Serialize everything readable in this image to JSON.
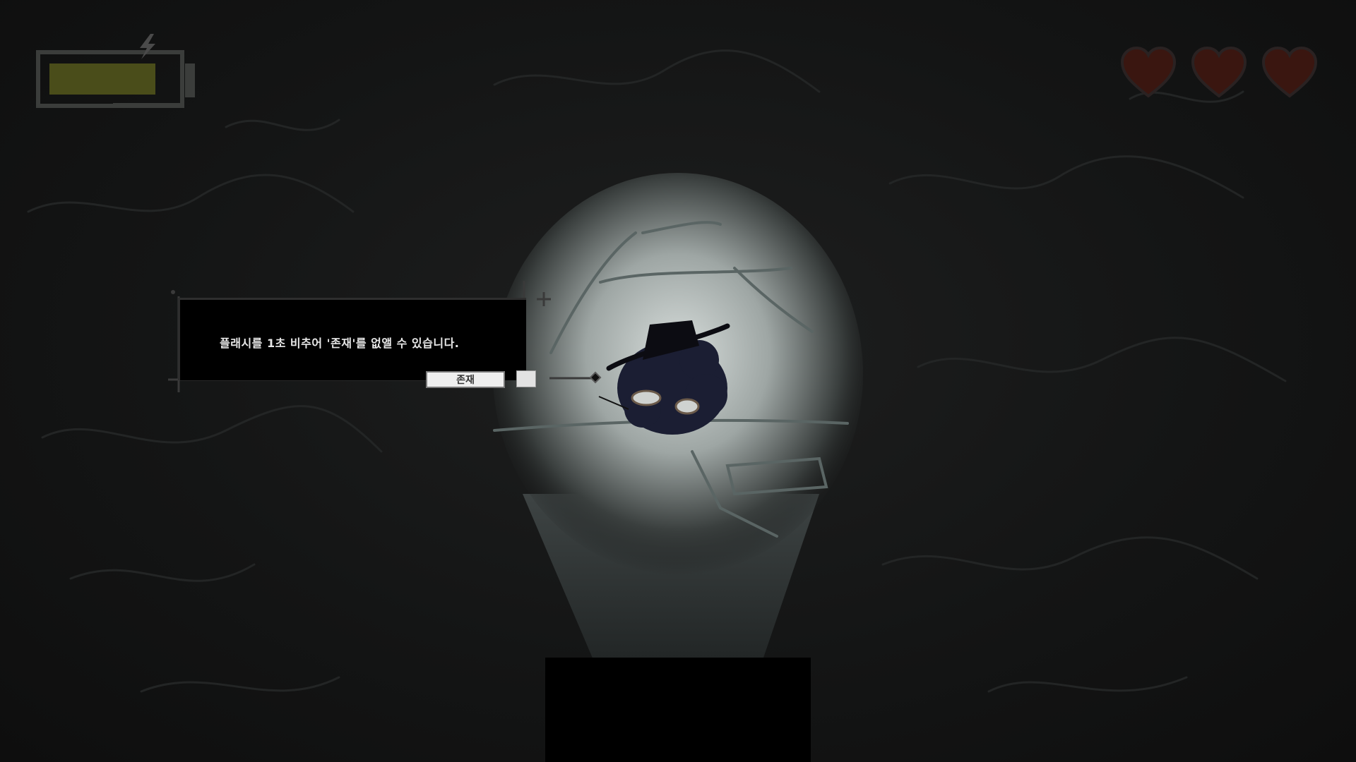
{
  "hud": {
    "battery_level": 0.85,
    "battery_fill_color": "#4a4d1a",
    "battery_icon": "lightning-icon",
    "hearts_total": 3,
    "hearts_filled": 3,
    "heart_color": "#3a1610",
    "heart_icon": "heart-icon"
  },
  "dialog": {
    "message": "플래시를 1초 비추어 '존재'를 없앨 수 있습니다.",
    "answer_label": "존재"
  },
  "scene": {
    "character_icon": "hat-shadow-creature-icon",
    "spotlight_color": "#c8cfcc"
  }
}
